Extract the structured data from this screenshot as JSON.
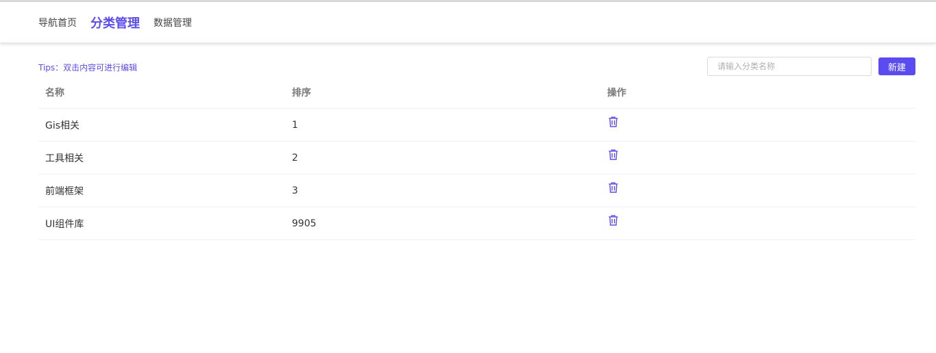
{
  "nav": {
    "items": [
      {
        "label": "导航首页",
        "active": false
      },
      {
        "label": "分类管理",
        "active": true
      },
      {
        "label": "数据管理",
        "active": false
      }
    ]
  },
  "toolbar": {
    "tips": "Tips：双击内容可进行编辑",
    "search_placeholder": "请输入分类名称",
    "new_label": "新建"
  },
  "table": {
    "headers": [
      "名称",
      "排序",
      "操作"
    ],
    "rows": [
      {
        "name": "Gis相关",
        "order": "1"
      },
      {
        "name": "工具相关",
        "order": "2"
      },
      {
        "name": "前端框架",
        "order": "3"
      },
      {
        "name": "UI组件库",
        "order": "9905"
      }
    ]
  },
  "colors": {
    "accent": "#5b4cf2",
    "icon": "delete-icon"
  }
}
